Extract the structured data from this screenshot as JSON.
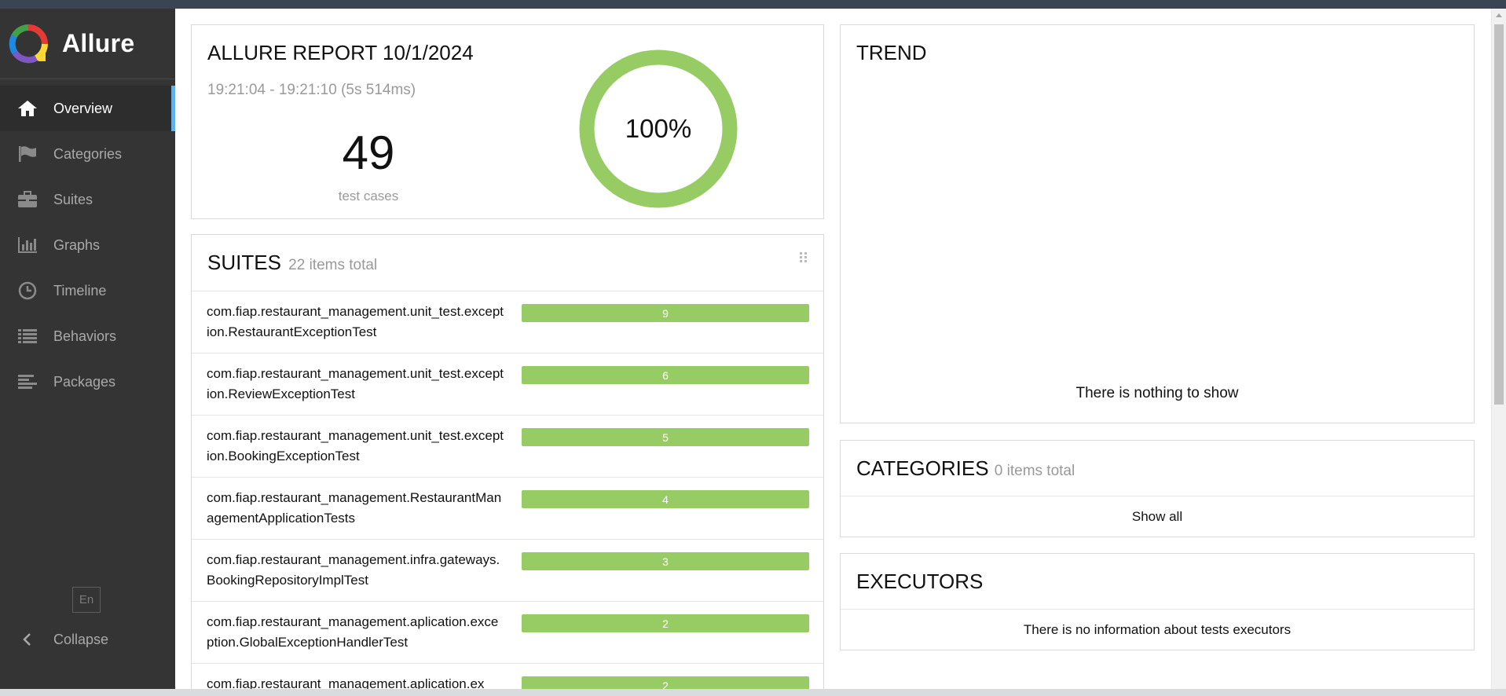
{
  "brand": {
    "name": "Allure"
  },
  "nav": {
    "items": [
      {
        "label": "Overview",
        "icon": "home-icon",
        "active": true
      },
      {
        "label": "Categories",
        "icon": "flag-icon",
        "active": false
      },
      {
        "label": "Suites",
        "icon": "briefcase-icon",
        "active": false
      },
      {
        "label": "Graphs",
        "icon": "bar-chart-icon",
        "active": false
      },
      {
        "label": "Timeline",
        "icon": "clock-icon",
        "active": false
      },
      {
        "label": "Behaviors",
        "icon": "list-icon",
        "active": false
      },
      {
        "label": "Packages",
        "icon": "align-left-icon",
        "active": false
      }
    ],
    "language": "En",
    "collapse_label": "Collapse"
  },
  "summary": {
    "title": "ALLURE REPORT 10/1/2024",
    "time_range": "19:21:04 - 19:21:10 (5s 514ms)",
    "test_count": "49",
    "test_count_label": "test cases",
    "percent_label": "100%",
    "passed_fraction": 1.0
  },
  "suites": {
    "title": "SUITES",
    "subtitle": "22 items total",
    "rows": [
      {
        "name": "com.fiap.restaurant_management.unit_test.exception.RestaurantExceptionTest",
        "count": "9"
      },
      {
        "name": "com.fiap.restaurant_management.unit_test.exception.ReviewExceptionTest",
        "count": "6"
      },
      {
        "name": "com.fiap.restaurant_management.unit_test.exception.BookingExceptionTest",
        "count": "5"
      },
      {
        "name": "com.fiap.restaurant_management.RestaurantManagementApplicationTests",
        "count": "4"
      },
      {
        "name": "com.fiap.restaurant_management.infra.gateways.BookingRepositoryImplTest",
        "count": "3"
      },
      {
        "name": "com.fiap.restaurant_management.aplication.exception.GlobalExceptionHandlerTest",
        "count": "2"
      },
      {
        "name": "com.fiap.restaurant_management.aplication.ex",
        "count": "2"
      }
    ]
  },
  "trend": {
    "title": "TREND",
    "empty_text": "There is nothing to show"
  },
  "categories": {
    "title": "CATEGORIES",
    "subtitle": "0 items total",
    "show_all": "Show all"
  },
  "executors": {
    "title": "EXECUTORS",
    "empty_text": "There is no information about tests executors"
  },
  "colors": {
    "passed": "#97cc64",
    "sidebar": "#343434",
    "accent": "#62b1e8"
  }
}
